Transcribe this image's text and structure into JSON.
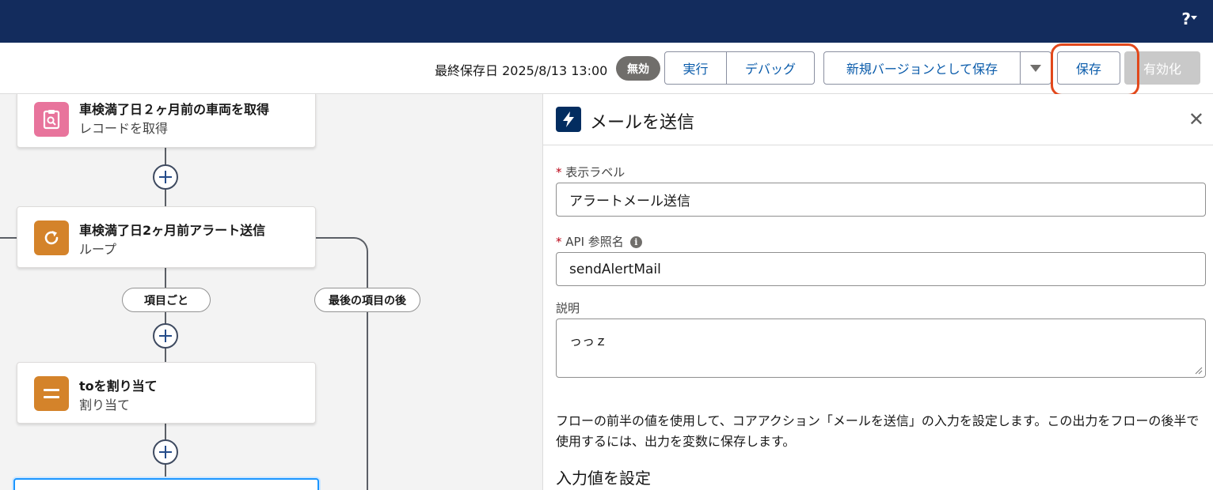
{
  "header": {
    "help_label": "?"
  },
  "toolbar": {
    "last_saved": "最終保存日 2025/8/13 13:00",
    "status_badge": "無効",
    "run_label": "実行",
    "debug_label": "デバッグ",
    "save_new_version_label": "新規バージョンとして保存",
    "save_label": "保存",
    "activate_label": "有効化"
  },
  "canvas": {
    "nodes": [
      {
        "title": "車検満了日２ヶ月前の車両を取得",
        "subtitle": "レコードを取得",
        "icon": "record-lookup-icon",
        "color": "#e8749c"
      },
      {
        "title": "車検満了日2ヶ月前アラート送信",
        "subtitle": "ループ",
        "icon": "loop-icon",
        "color": "#d4832a"
      },
      {
        "title": "toを割り当て",
        "subtitle": "割り当て",
        "icon": "assignment-icon",
        "color": "#d4832a"
      }
    ],
    "for_each_label": "項目ごと",
    "after_last_label": "最後の項目の後"
  },
  "panel": {
    "title": "メールを送信",
    "icon": "lightning-icon",
    "label_field": {
      "label": "表示ラベル",
      "value": "アラートメール送信"
    },
    "api_field": {
      "label": "API 参照名",
      "value": "sendAlertMail"
    },
    "description_field": {
      "label": "説明",
      "value": "っっｚ"
    },
    "help_text": "フローの前半の値を使用して、コアアクション「メールを送信」の入力を設定します。この出力をフローの後半で使用するには、出力を変数に保存します。",
    "section_title": "入力値を設定"
  },
  "colors": {
    "header_bg": "#132c5d",
    "brand_blue": "#0b5cab",
    "highlight": "#e2481b"
  }
}
